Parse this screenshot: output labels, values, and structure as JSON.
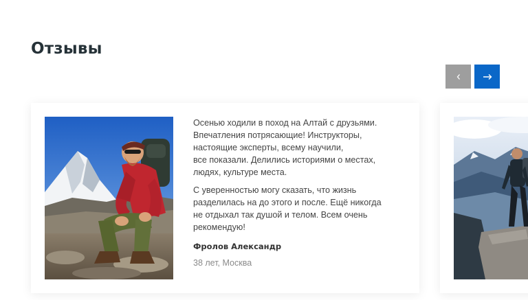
{
  "section": {
    "title": "Отзывы"
  },
  "slider": {
    "prev_icon": "chevron-left-icon",
    "next_icon": "arrow-right-icon",
    "prev_color": "#9e9e9e",
    "next_color": "#0a67c8"
  },
  "reviews": [
    {
      "paragraphs": [
        [
          "Осенью ходили в поход на Алтай с друзьями.",
          "Впечатления потрясающие! Инструкторы,",
          "настоящие эксперты, всему научили,",
          "все показали. Делились историями о местах,",
          "людях, культуре места."
        ],
        [
          "С уверенностью могу сказать, что жизнь",
          "разделилась на до этого и после. Ещё никогда",
          "не отдыхал так душой и телом. Всем очень",
          "рекомендую!"
        ]
      ],
      "author": "Фролов Александр",
      "meta": "38 лет, Москва",
      "photo": "hiker-in-mountains-photo"
    },
    {
      "photo": "hiker-on-cliff-photo"
    }
  ]
}
